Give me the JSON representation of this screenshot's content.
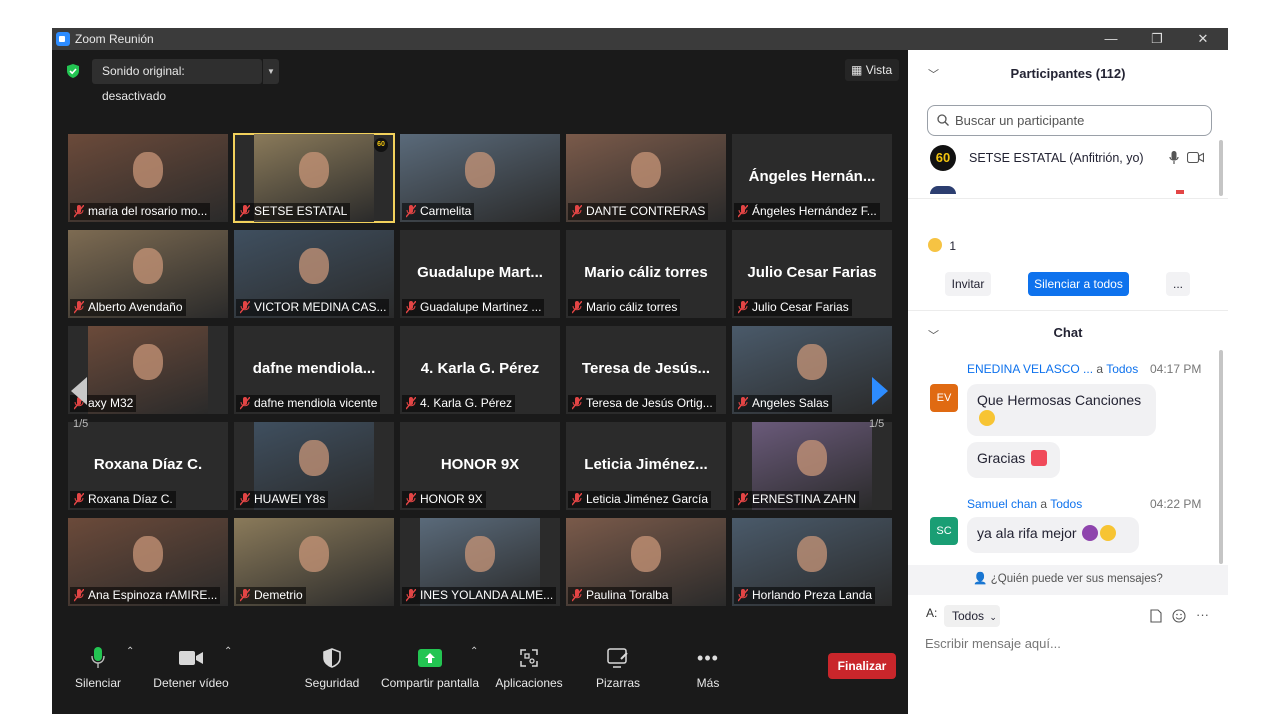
{
  "window": {
    "title": "Zoom Reunión",
    "minimize": "—",
    "restore": "❐",
    "close": "✕"
  },
  "top_bar": {
    "audio_label": "Sonido original: desactivado",
    "view_label": "Vista"
  },
  "grid": {
    "page_indicator": "1/5",
    "tiles": [
      {
        "name": "maria del rosario mo...",
        "video": true
      },
      {
        "name": "SETSE ESTATAL",
        "video": true,
        "active": true,
        "badge": "60"
      },
      {
        "name": "Carmelita",
        "video": true
      },
      {
        "name": "DANTE CONTRERAS",
        "video": true
      },
      {
        "name": "Ángeles Hernández F...",
        "big": "Ángeles  Hernán..."
      },
      {
        "name": "Alberto Avendaño",
        "video": true
      },
      {
        "name": "VICTOR MEDINA CAS...",
        "video": true
      },
      {
        "name": "Guadalupe Martinez ...",
        "big": "Guadalupe  Mart..."
      },
      {
        "name": "Mario cáliz torres",
        "big": "Mario cáliz torres"
      },
      {
        "name": "Julio Cesar Farias",
        "big": "Julio Cesar Farias"
      },
      {
        "name": "axy M32",
        "video": true
      },
      {
        "name": "dafne mendiola vicente",
        "big": "dafne  mendiola..."
      },
      {
        "name": "4. Karla G. Pérez",
        "big": "4. Karla G. Pérez"
      },
      {
        "name": "Teresa de Jesús Ortig...",
        "big": "Teresa de Jesús..."
      },
      {
        "name": "Angeles Salas",
        "video": true
      },
      {
        "name": "Roxana Díaz C.",
        "big": "Roxana Díaz C."
      },
      {
        "name": "HUAWEI Y8s",
        "video": true
      },
      {
        "name": "HONOR 9X",
        "big": "HONOR 9X"
      },
      {
        "name": "Leticia Jiménez García",
        "big": "Leticia  Jiménez..."
      },
      {
        "name": "ERNESTINA ZAHN",
        "video": true
      },
      {
        "name": "Ana Espinoza rAMIRE...",
        "video": true
      },
      {
        "name": "Demetrio",
        "video": true
      },
      {
        "name": "INES YOLANDA ALME...",
        "video": true
      },
      {
        "name": "Paulina Toralba",
        "video": true
      },
      {
        "name": "Horlando Preza Landa",
        "video": true
      }
    ]
  },
  "toolbar": {
    "mute": "Silenciar",
    "video": "Detener vídeo",
    "security": "Seguridad",
    "share": "Compartir pantalla",
    "apps": "Aplicaciones",
    "whiteboards": "Pizarras",
    "more": "Más",
    "end": "Finalizar"
  },
  "participants": {
    "title": "Participantes (112)",
    "search_placeholder": "Buscar un participante",
    "host_name": "SETSE ESTATAL (Anfitrión, yo)",
    "host_avatar": "60",
    "reaction_count": "1",
    "invite": "Invitar",
    "mute_all": "Silenciar a todos",
    "more": "..."
  },
  "chat": {
    "title": "Chat",
    "messages": [
      {
        "initials": "EV",
        "sender": "ENEDINA VELASCO ...",
        "to_word": "a",
        "to": "Todos",
        "time": "04:17 PM",
        "texts": [
          "Que Hermosas Canciones",
          "Gracias"
        ]
      },
      {
        "initials": "SC",
        "sender": "Samuel chan",
        "to_word": "a",
        "to": "Todos",
        "time": "04:22 PM",
        "texts": [
          "ya ala rifa mejor"
        ]
      }
    ],
    "who_can_see": "¿Quién puede ver sus mensajes?",
    "to_label": "A:",
    "to_value": "Todos",
    "compose_placeholder": "Escribir mensaje aquí...",
    "more_dots": "···"
  },
  "colors": {
    "accent": "#2d8cff",
    "share_green": "#2fb55f",
    "end_red": "#c9262b",
    "active_tile": "#f2d15c",
    "chat_blue": "#0e72ed"
  }
}
